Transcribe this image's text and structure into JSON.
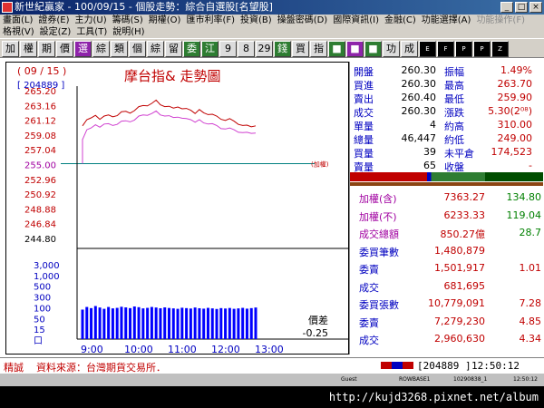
{
  "window": {
    "title": "新世紀贏家 - 100/09/15 - 個股走勢：綜合自選股[名望股]"
  },
  "menu_row1": [
    "畫面(L)",
    "證券(E)",
    "主力(U)",
    "籌碼(S)",
    "期權(O)",
    "匯市利率(F)",
    "投資(B)",
    "操盤密碼(D)",
    "國際資訊(I)",
    "金融(C)",
    "功能選擇(A)",
    "功能操作(F)"
  ],
  "menu_row2": [
    "格視(V)",
    "設定(Z)",
    "工具(T)",
    "說明(H)"
  ],
  "toolbar": [
    "加",
    "權",
    "期",
    "價",
    "選",
    "綜",
    "類",
    "個",
    "綜",
    "留",
    "委",
    "江",
    "9",
    "8",
    "29",
    "錢",
    "買",
    "指",
    "■",
    "■",
    "■",
    "功",
    "成",
    "E",
    "F",
    "P",
    "P",
    "Z"
  ],
  "chart": {
    "date": "( 09 / 15 )",
    "code": "[ 204889 ]",
    "title": "摩台指& 走勢圖",
    "price_labels": [
      "265.20",
      "263.16",
      "261.12",
      "259.08",
      "257.04",
      "255.00",
      "252.96",
      "250.92",
      "248.88",
      "246.84",
      "244.80"
    ],
    "ref_price": "255.00",
    "ref_tag": "(加權)",
    "volume_labels": [
      "3,000",
      "1,000",
      "500",
      "300",
      "100",
      "50",
      "15",
      "口"
    ],
    "time_labels": [
      "9:00",
      "10:00",
      "11:00",
      "12:00",
      "13:00"
    ],
    "spread_label": "價差",
    "spread_value": "-0.25"
  },
  "chart_data": {
    "type": "line",
    "series": [
      {
        "values": [
          260.3,
          261.0,
          261.4,
          261.6,
          261.2,
          261.5,
          261.8,
          261.4,
          261.7,
          262.1,
          262.3,
          261.9,
          262.4,
          262.8,
          263.1,
          262.9,
          263.4,
          263.7,
          263.2,
          262.8,
          263.0,
          262.6,
          262.9,
          262.5,
          262.7,
          262.3,
          262.0,
          262.4,
          262.1,
          261.7,
          261.9,
          261.5,
          261.2,
          260.9,
          261.3,
          260.8,
          260.5,
          260.2,
          260.4,
          260.0,
          260.3
        ]
      },
      {
        "values": [
          258.4,
          259.6,
          260.0,
          260.3,
          260.1,
          260.4,
          260.6,
          260.2,
          260.5,
          260.8,
          261.0,
          260.7,
          261.1,
          261.5,
          261.8,
          261.6,
          262.0,
          262.2,
          261.8,
          261.5,
          261.7,
          261.3,
          261.5,
          261.2,
          261.3,
          261.0,
          260.8,
          261.0,
          260.7,
          260.4,
          260.6,
          260.2,
          259.9,
          259.7,
          260.0,
          259.6,
          259.4,
          259.2,
          259.4,
          259.1,
          259.3
        ]
      }
    ],
    "volume": [
      300,
      500,
      400,
      600,
      450,
      350,
      500,
      380,
      420,
      520,
      460,
      400,
      550,
      480,
      380,
      420,
      500,
      450,
      390,
      460,
      410,
      380,
      350,
      430,
      400,
      370,
      450,
      390,
      360,
      420,
      380,
      340,
      400,
      370,
      410,
      350,
      380,
      420,
      360,
      400,
      450
    ],
    "ylim": [
      244.8,
      265.2
    ],
    "xlim": [
      "8:45",
      "13:45"
    ]
  },
  "quote": {
    "rows": [
      {
        "l1": "開盤",
        "v1": "260.30",
        "l2": "振幅",
        "v2": "1.49%"
      },
      {
        "l1": "買進",
        "v1": "260.30",
        "l2": "最高",
        "v2": "263.70"
      },
      {
        "l1": "賣出",
        "v1": "260.40",
        "l2": "最低",
        "v2": "259.90"
      },
      {
        "l1": "成交",
        "v1": "260.30",
        "l2": "漲跌",
        "v2": "5.30(2⁰⁸)"
      },
      {
        "l1": "單量",
        "v1": "4",
        "l2": "約高",
        "v2": "310.00"
      },
      {
        "l1": "總量",
        "v1": "46,447",
        "l2": "約低",
        "v2": "249.00"
      },
      {
        "l1": "買量",
        "v1": "39",
        "l2": "未平倉",
        "v2": "174,523"
      },
      {
        "l1": "賣量",
        "v1": "65",
        "l2": "收盤",
        "v2": "-"
      }
    ],
    "index_rows": [
      {
        "l": "加權(含)",
        "v1": "7363.27",
        "v2": "134.80"
      },
      {
        "l": "加權(不)",
        "v1": "6233.33",
        "v2": "119.04"
      },
      {
        "l": "成交總額",
        "v1": "850.27億",
        "v2": "28.7"
      },
      {
        "l": "委買筆數",
        "v1": "1,480,879",
        "v2": ""
      },
      {
        "l": "委賣",
        "v1": "1,501,917",
        "v2": "1.01"
      },
      {
        "l": "成交",
        "v1": "681,695",
        "v2": ""
      },
      {
        "l": "委買張數",
        "v1": "10,779,091",
        "v2": "7.28"
      },
      {
        "l": "委賣",
        "v1": "7,279,230",
        "v2": "4.85"
      },
      {
        "l": "成交",
        "v1": "2,960,630",
        "v2": "4.34"
      }
    ]
  },
  "status": {
    "tag": "精誠",
    "source": "資料來源：台灣期貨交易所．",
    "code": "[204889 ]",
    "time": "12:50:12"
  },
  "bottom": {
    "user": "Guest",
    "server": "ROWBASE1",
    "build": "10290838_1",
    "clock": "12:50:12"
  },
  "url": "http://kujd3268.pixnet.net/album",
  "colors": {
    "price_up": "#c00000",
    "index_line": "#d040d0",
    "volume": "#0000ff",
    "ref_line": "#008080",
    "label_blue": "#0000c0"
  }
}
